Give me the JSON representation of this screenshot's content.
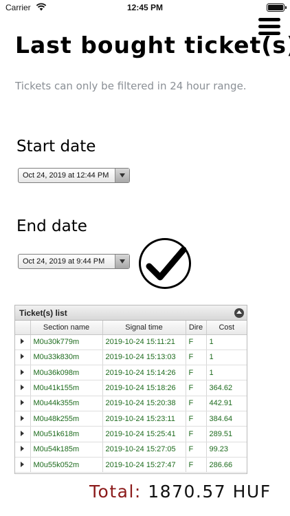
{
  "status_bar": {
    "carrier": "Carrier",
    "time": "12:45 PM"
  },
  "header": {
    "title": "Last bought ticket(s)",
    "menu_icon": "hamburger-menu-icon"
  },
  "hint": "Tickets can only be filtered in 24 hour range.",
  "filter": {
    "start_label": "Start date",
    "start_value": "Oct 24, 2019 at 12:44 PM",
    "end_label": "End date",
    "end_value": "Oct 24, 2019 at 9:44 PM",
    "confirm_icon": "checkmark-icon"
  },
  "tickets": {
    "title": "Ticket(s) list",
    "columns": [
      "Section name",
      "Signal time",
      "Dire",
      "Cost"
    ],
    "rows": [
      {
        "section": "M0u30k779m",
        "time": "2019-10-24 15:11:21",
        "dir": "F",
        "cost": "1"
      },
      {
        "section": "M0u33k830m",
        "time": "2019-10-24 15:13:03",
        "dir": "F",
        "cost": "1"
      },
      {
        "section": "M0u36k098m",
        "time": "2019-10-24 15:14:26",
        "dir": "F",
        "cost": "1"
      },
      {
        "section": "M0u41k155m",
        "time": "2019-10-24 15:18:26",
        "dir": "F",
        "cost": "364.62"
      },
      {
        "section": "M0u44k355m",
        "time": "2019-10-24 15:20:38",
        "dir": "F",
        "cost": "442.91"
      },
      {
        "section": "M0u48k255m",
        "time": "2019-10-24 15:23:11",
        "dir": "F",
        "cost": "384.64"
      },
      {
        "section": "M0u51k618m",
        "time": "2019-10-24 15:25:41",
        "dir": "F",
        "cost": "289.51"
      },
      {
        "section": "M0u54k185m",
        "time": "2019-10-24 15:27:05",
        "dir": "F",
        "cost": "99.23"
      },
      {
        "section": "M0u55k052m",
        "time": "2019-10-24 15:27:47",
        "dir": "F",
        "cost": "286.66"
      }
    ]
  },
  "total": {
    "label": "Total:",
    "value": "1870.57 HUF"
  }
}
